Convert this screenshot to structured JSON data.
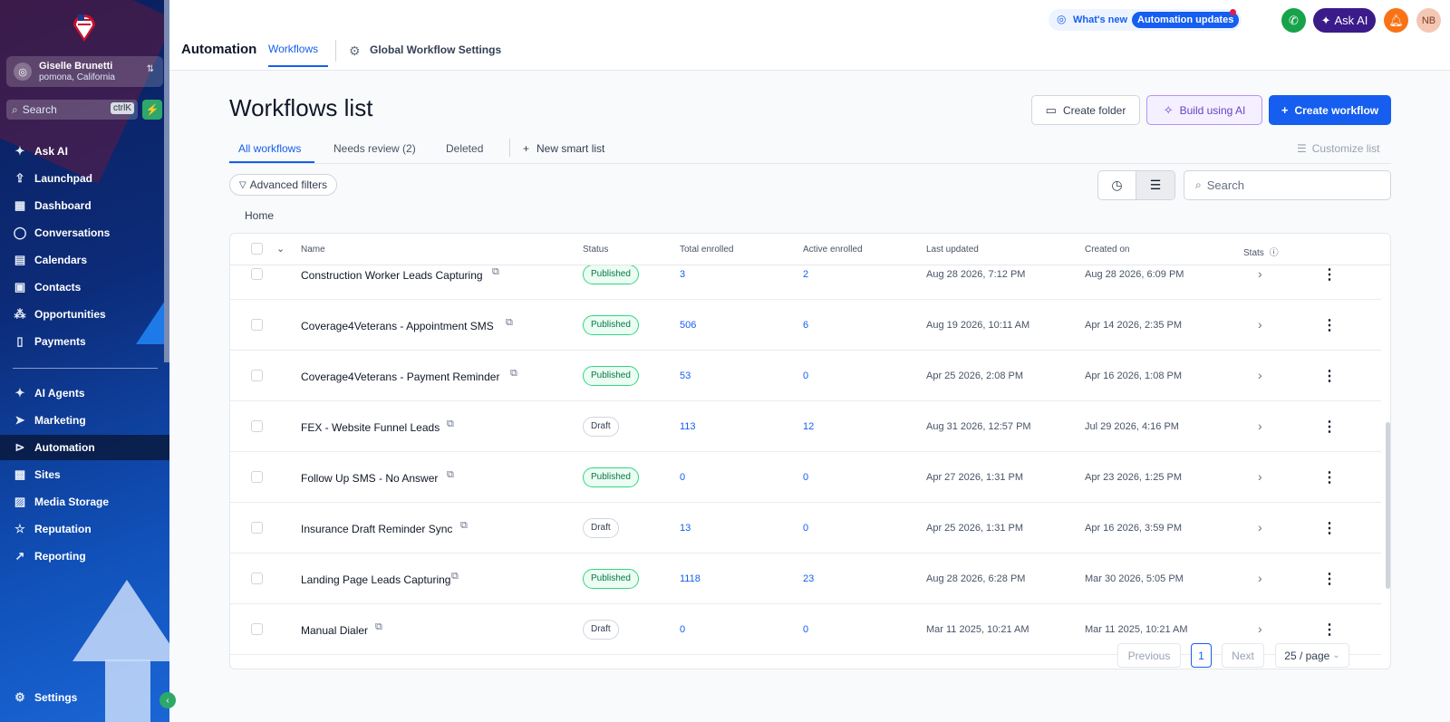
{
  "sidebar": {
    "account_name": "Giselle Brunetti",
    "account_location": "pomona, California",
    "search_placeholder": "Search",
    "search_shortcut": "ctrlK",
    "nav_top": [
      {
        "label": "Ask AI",
        "icon": "sparkle-icon"
      },
      {
        "label": "Launchpad",
        "icon": "rocket-icon"
      },
      {
        "label": "Dashboard",
        "icon": "grid-icon"
      },
      {
        "label": "Conversations",
        "icon": "chat-icon"
      },
      {
        "label": "Calendars",
        "icon": "calendar-icon"
      },
      {
        "label": "Contacts",
        "icon": "contacts-icon"
      },
      {
        "label": "Opportunities",
        "icon": "pipeline-icon"
      },
      {
        "label": "Payments",
        "icon": "receipt-icon"
      }
    ],
    "nav_bottom": [
      {
        "label": "AI Agents",
        "icon": "sparkle-icon"
      },
      {
        "label": "Marketing",
        "icon": "send-icon"
      },
      {
        "label": "Automation",
        "icon": "automation-icon",
        "active": true
      },
      {
        "label": "Sites",
        "icon": "globe-icon"
      },
      {
        "label": "Media Storage",
        "icon": "image-icon"
      },
      {
        "label": "Reputation",
        "icon": "star-icon"
      },
      {
        "label": "Reporting",
        "icon": "chart-line-icon"
      }
    ],
    "settings_label": "Settings"
  },
  "topbar": {
    "title": "Automation",
    "tab_workflows": "Workflows",
    "tab_global_settings": "Global Workflow Settings",
    "whats_new": "What's new",
    "automation_updates": "Automation updates",
    "ask_ai": "Ask AI",
    "user_initials": "NB"
  },
  "main": {
    "page_title": "Workflows list",
    "create_folder": "Create folder",
    "build_ai": "Build using AI",
    "create_workflow": "Create workflow",
    "tabs": [
      "All workflows",
      "Needs review (2)",
      "Deleted"
    ],
    "new_smart_list": "New smart list",
    "customize_list": "Customize list",
    "advanced_filters": "Advanced filters",
    "search_placeholder": "Search",
    "breadcrumb": "Home"
  },
  "table": {
    "columns": [
      "Name",
      "Status",
      "Total enrolled",
      "Active enrolled",
      "Last updated",
      "Created on",
      "Stats"
    ],
    "rows": [
      {
        "name": "Construction Worker Leads Capturing",
        "status": "Published",
        "total": "3",
        "active": "2",
        "updated": "Aug 28 2026, 7:12 PM",
        "created": "Aug 28 2026, 6:09 PM"
      },
      {
        "name": "Coverage4Veterans - Appointment SMS",
        "status": "Published",
        "total": "506",
        "active": "6",
        "updated": "Aug 19 2026, 10:11 AM",
        "created": "Apr 14 2026, 2:35 PM"
      },
      {
        "name": "Coverage4Veterans - Payment Reminder",
        "status": "Published",
        "total": "53",
        "active": "0",
        "updated": "Apr 25 2026, 2:08 PM",
        "created": "Apr 16 2026, 1:08 PM"
      },
      {
        "name": "FEX - Website Funnel Leads",
        "status": "Draft",
        "total": "113",
        "active": "12",
        "updated": "Aug 31 2026, 12:57 PM",
        "created": "Jul 29 2026, 4:16 PM"
      },
      {
        "name": "Follow Up SMS - No Answer",
        "status": "Published",
        "total": "0",
        "active": "0",
        "updated": "Apr 27 2026, 1:31 PM",
        "created": "Apr 23 2026, 1:25 PM"
      },
      {
        "name": "Insurance Draft Reminder Sync",
        "status": "Draft",
        "total": "13",
        "active": "0",
        "updated": "Apr 25 2026, 1:31 PM",
        "created": "Apr 16 2026, 3:59 PM"
      },
      {
        "name": "Landing Page Leads Capturing",
        "status": "Published",
        "total": "1118",
        "active": "23",
        "updated": "Aug 28 2026, 6:28 PM",
        "created": "Mar 30 2026, 5:05 PM"
      },
      {
        "name": "Manual Dialer",
        "status": "Draft",
        "total": "0",
        "active": "0",
        "updated": "Mar 11 2025, 10:21 AM",
        "created": "Mar 11 2025, 10:21 AM"
      }
    ]
  },
  "pagination": {
    "previous": "Previous",
    "current_page": "1",
    "next": "Next",
    "per_page": "25 / page"
  }
}
